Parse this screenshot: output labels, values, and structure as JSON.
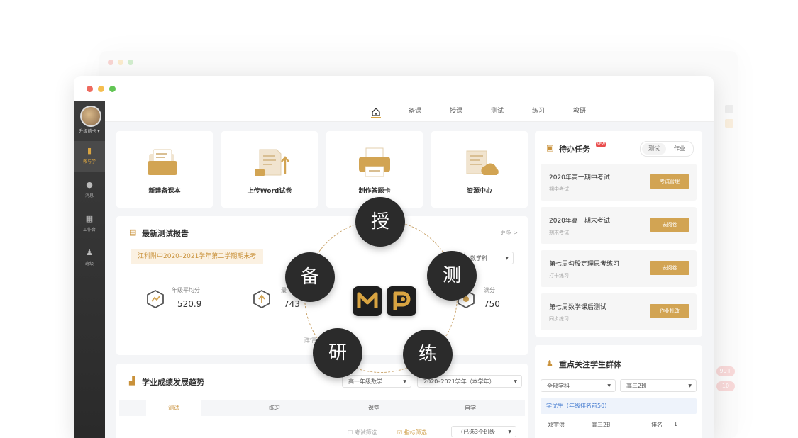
{
  "colors": {
    "accent": "#d2a453",
    "sidebar": "#333333",
    "dot_red": "#ee6a5f",
    "dot_yellow": "#f5be4f",
    "dot_green": "#62c554"
  },
  "ghost": {
    "badges": [
      "99+",
      "10"
    ]
  },
  "sidebar": {
    "user_label": "升级前卡 ▾",
    "items": [
      {
        "icon": "book-icon",
        "label": "教与学"
      },
      {
        "icon": "message-icon",
        "label": "消息"
      },
      {
        "icon": "grid-icon",
        "label": "工作台"
      },
      {
        "icon": "people-icon",
        "label": "班级"
      }
    ]
  },
  "topnav": {
    "home_icon": "home-icon",
    "items": [
      "备课",
      "授课",
      "测试",
      "练习",
      "教研"
    ]
  },
  "tools": [
    {
      "label": "新建备课本",
      "icon": "folder-icon"
    },
    {
      "label": "上传Word试卷",
      "icon": "upload-doc-icon"
    },
    {
      "label": "制作答题卡",
      "icon": "printer-icon"
    },
    {
      "label": "资源中心",
      "icon": "cloud-doc-icon"
    }
  ],
  "report": {
    "title": "最新测试报告",
    "more": "更多 >",
    "tag": "江科附中2020–2021学年第二学期期末考",
    "subject_select": "数学科",
    "detail": "详情",
    "stats": [
      {
        "label": "年级平均分",
        "value": "520.9"
      },
      {
        "label": "最",
        "value": "743"
      },
      {
        "label": "满分",
        "value": "750"
      }
    ]
  },
  "trend": {
    "title": "学业成绩发展趋势",
    "grade_select": "高一年级数学",
    "year_select": "2020–2021学年（本学年）",
    "tabs": [
      "测试",
      "练习",
      "课堂",
      "自学"
    ],
    "filters": [
      "考试筛选",
      "指标筛选"
    ],
    "filter_select": "（已选3个班级"
  },
  "tasks": {
    "title": "待办任务",
    "hot_badge": "NEW",
    "toggle": [
      "测试",
      "作业"
    ],
    "items": [
      {
        "title": "2020年高一期中考试",
        "sub": "期中考试",
        "action": "考试管理"
      },
      {
        "title": "2020年高一期末考试",
        "sub": "期末考试",
        "action": "去阅卷"
      },
      {
        "title": "第七周勾股定理思考练习",
        "sub": "打卡练习",
        "action": "去阅卷"
      },
      {
        "title": "第七周数学课后测试",
        "sub": "同步练习",
        "action": "作业批改"
      }
    ]
  },
  "focus": {
    "title": "重点关注学生群体",
    "subject_select": "全部学科",
    "class_select": "高三2班",
    "group": "学优生（年级排名前50）",
    "row": {
      "name": "郑宇洪",
      "class": "高三2班",
      "rank_label": "排名",
      "rank": "1"
    }
  },
  "overlay": {
    "bubbles": [
      "授",
      "测",
      "练",
      "研",
      "备"
    ]
  }
}
